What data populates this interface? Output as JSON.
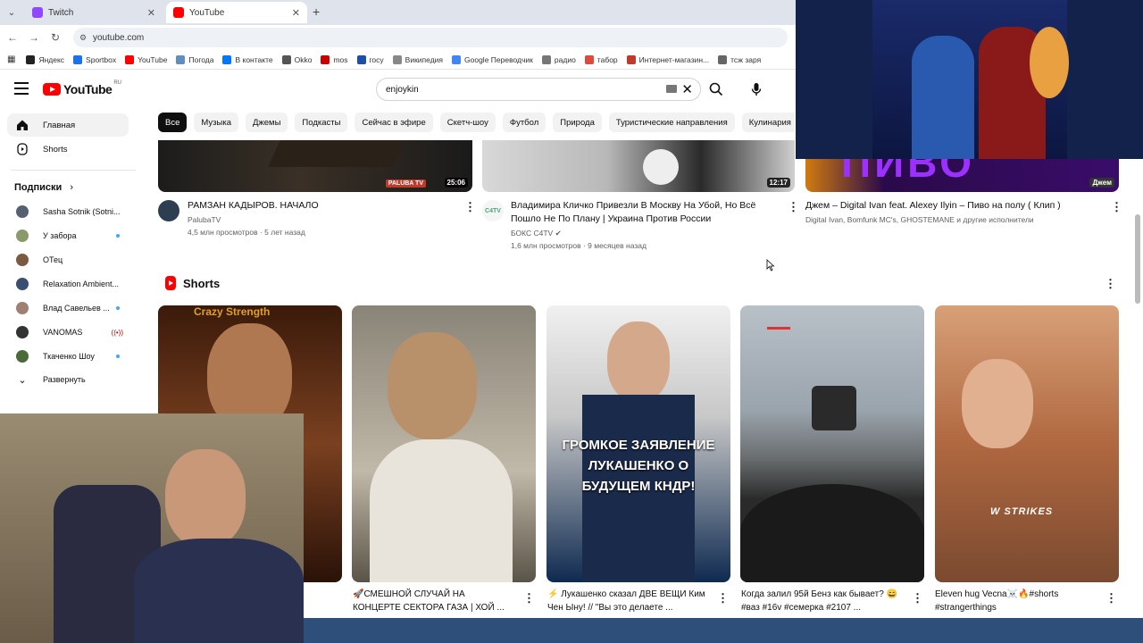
{
  "browser": {
    "tabs": [
      {
        "label": "Twitch",
        "color": "#9146ff"
      },
      {
        "label": "YouTube",
        "color": "#ff0000"
      }
    ],
    "new_tab_icon": "plus-icon",
    "url": "youtube.com",
    "bookmarks": [
      {
        "label": "Яндекс",
        "color": "#222222"
      },
      {
        "label": "Sportbox",
        "color": "#1a73e8"
      },
      {
        "label": "YouTube",
        "color": "#ff0000"
      },
      {
        "label": "Погода",
        "color": "#5f8fc0"
      },
      {
        "label": "В контакте",
        "color": "#0077ff"
      },
      {
        "label": "Okko",
        "color": "#555555"
      },
      {
        "label": "mos",
        "color": "#cc0000"
      },
      {
        "label": "госу",
        "color": "#1d4fa6"
      },
      {
        "label": "Википедия",
        "color": "#888888"
      },
      {
        "label": "Google Переводчик",
        "color": "#4285f4"
      },
      {
        "label": "радио",
        "color": "#777777"
      },
      {
        "label": "табор",
        "color": "#e04a3a"
      },
      {
        "label": "Интернет-магазин...",
        "color": "#c0392b"
      },
      {
        "label": "тсж заря",
        "color": "#666666"
      }
    ]
  },
  "header": {
    "logo_text": "YouTube",
    "logo_region": "RU",
    "search_value": "enjoykin"
  },
  "chips": [
    "Все",
    "Музыка",
    "Джемы",
    "Подкасты",
    "Сейчас в эфире",
    "Скетч-шоу",
    "Футбол",
    "Природа",
    "Туристические направления",
    "Кулинария"
  ],
  "sidebar": {
    "main": [
      {
        "label": "Главная",
        "icon": "home-icon"
      },
      {
        "label": "Shorts",
        "icon": "shorts-icon"
      }
    ],
    "subs_heading": "Подписки",
    "subscriptions": [
      {
        "name": "Sasha Sotnik (Sotni...",
        "color": "#556070",
        "badge": ""
      },
      {
        "name": "У забора",
        "color": "#8b9a6a",
        "badge": "dot"
      },
      {
        "name": "ОТец",
        "color": "#7a5a40",
        "badge": ""
      },
      {
        "name": "Relaxation Ambient...",
        "color": "#3a5070",
        "badge": ""
      },
      {
        "name": "Влад Савельев ...",
        "color": "#a08070",
        "badge": "dot"
      },
      {
        "name": "VANOMAS",
        "color": "#333333",
        "badge": "live"
      },
      {
        "name": "Ткаченко Шоу",
        "color": "#4a6a3a",
        "badge": "dot"
      }
    ],
    "expand_label": "Развернуть"
  },
  "videos": [
    {
      "title": "РАМЗАН КАДЫРОВ. НАЧАЛО",
      "channel": "PalubaTV",
      "stats": "4,5 млн просмотров · 5 лет назад",
      "duration": "25:06",
      "verified": false
    },
    {
      "title": "Владимира Кличко Привезли В Москву На Убой, Но Всё Пошло Не По Плану | Украина Против России",
      "channel": "БОКС C4TV",
      "stats": "1,6 млн просмотров · 9 месяцев назад",
      "duration": "12:17",
      "verified": true
    },
    {
      "title": "Джем – Digital Ivan feat. Alexey Ilyin – Пиво на полу ( Клип )",
      "channel": "Digital Ivan, Bomfunk MC's, GHOSTEMANE и другие исполнители",
      "stats": "",
      "duration": "Джем",
      "verified": false
    }
  ],
  "shorts": {
    "heading": "Shorts",
    "items": [
      {
        "title": ""
      },
      {
        "title": "🚀СМЕШНОЙ СЛУЧАЙ НА КОНЦЕРТЕ СЕКТОРА ГАЗА | ХОЙ ..."
      },
      {
        "title": "⚡ Лукашенко сказал ДВЕ ВЕЩИ Ким Чен Ыну! // \"Вы это делаете ...",
        "overlay": "ГРОМКОЕ ЗАЯВЛЕНИЕ ЛУКАШЕНКО О БУДУЩЕМ КНДР!"
      },
      {
        "title": "Когда залил 95й Бенз как бывает? 😄 #ваз #16v #семерка #2107 ..."
      },
      {
        "title": "Eleven hug Vecna☠️🔥#shorts #strangerthings",
        "overlay": "W STRIKES"
      }
    ]
  }
}
